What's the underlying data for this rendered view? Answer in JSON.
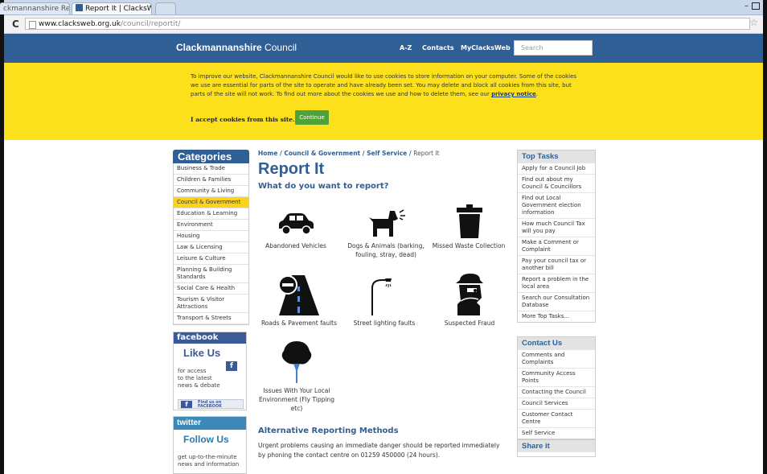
{
  "browser": {
    "tabs": [
      {
        "label": "ckmannanshire Re"
      },
      {
        "label": "Report It | ClacksWe"
      },
      {
        "label": ""
      }
    ],
    "url_host": "www.clacksweb.org.uk",
    "url_path": "/council/reportit/"
  },
  "header": {
    "brand_bold": "Clackmannanshire",
    "brand_rest": " Council",
    "nav": [
      "A-Z",
      "Contacts",
      "MyClacksWeb"
    ],
    "search_placeholder": "Search"
  },
  "cookie": {
    "text": "To improve our website, Clackmannanshire Council would like to use cookies to store information on your computer. Some of the cookies we use are essential for parts of the site to operate and have already been set. You may delete and block all cookies from this site, but parts of the site will not work. To find out more about the cookies we use and how to delete them, see our ",
    "link": "privacy notice",
    "accept_label": "I accept cookies from this site.",
    "continue_label": "Continue"
  },
  "categories": {
    "title": "Categories",
    "items": [
      "Business & Trade",
      "Children & Families",
      "Community & Living",
      "Council & Government",
      "Education & Learning",
      "Environment",
      "Housing",
      "Law & Licensing",
      "Leisure & Culture",
      "Planning & Building Standards",
      "Social Care & Health",
      "Tourism & Visitor Attractions",
      "Transport & Streets"
    ],
    "active_index": 3
  },
  "facebook": {
    "head": "facebook",
    "like": "Like Us",
    "text_lines": [
      "for access",
      "to the latest",
      "news & debate"
    ],
    "find_line1": "Find us on",
    "find_line2": "FACEBOOK"
  },
  "twitter": {
    "head": "twitter",
    "follow": "Follow Us",
    "text_lines": [
      "get up-to-the-minute",
      "news and information"
    ]
  },
  "main": {
    "breadcrumb": [
      "Home",
      "Council & Government",
      "Self Service"
    ],
    "breadcrumb_current": "Report It",
    "title": "Report It",
    "subtitle": "What do you want to report?",
    "items": [
      {
        "label": "Abandoned Vehicles",
        "icon": "car-icon"
      },
      {
        "label": "Dogs & Animals (barking, fouling, stray, dead)",
        "icon": "dog-icon"
      },
      {
        "label": "Missed Waste Collection",
        "icon": "bin-icon"
      },
      {
        "label": "Roads & Pavement faults",
        "icon": "road-icon"
      },
      {
        "label": "Street lighting faults",
        "icon": "streetlight-icon"
      },
      {
        "label": "Suspected Fraud",
        "icon": "fraud-icon"
      },
      {
        "label": "Issues With Your Local Environment (Fly Tipping etc)",
        "icon": "tree-icon"
      }
    ],
    "alt_title": "Alternative Reporting Methods",
    "alt_text": "Urgent problems causing an immediate danger should be reported immediately by phoning the contact centre on 01259 450000 (24 hours)."
  },
  "top_tasks": {
    "title": "Top Tasks",
    "items": [
      "Apply for a Council Job",
      "Find out about my Council & Councillors",
      "Find out Local Government election information",
      "How much Council Tax will you pay",
      "Make a Comment or Complaint",
      "Pay your council tax or another bill",
      "Report a problem in the local area",
      "Search our Consultation Database",
      "More Top Tasks..."
    ]
  },
  "contact_us": {
    "title": "Contact Us",
    "items": [
      "Comments and Complaints",
      "Community Access Points",
      "Contacting the Council",
      "Council Services",
      "Customer Contact Centre",
      "Self Service"
    ]
  },
  "share": {
    "title": "Share it"
  }
}
